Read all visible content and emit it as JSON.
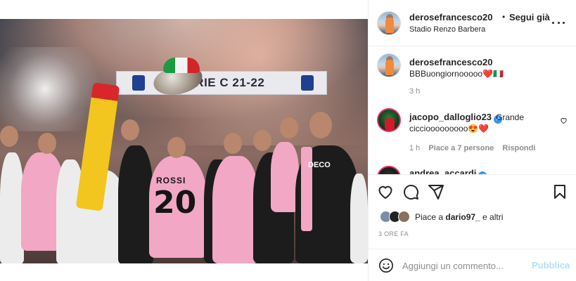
{
  "post": {
    "header": {
      "username": "derosefrancesco20",
      "dot": "•",
      "follow_label": "Segui già",
      "location": "Stadio Renzo Barbera"
    },
    "caption": {
      "username": "derosefrancesco20",
      "text": "BBBuongiornooooo❤️🇮🇹",
      "time": "3 h"
    },
    "comments": [
      {
        "username": "jacopo_dalloglio23",
        "verified": true,
        "text_line1": "Grande",
        "text_line2": "cicciooooooooo😍❤️",
        "time": "1 h",
        "likes": "Piace a 7 persone",
        "reply": "Rispondi"
      },
      {
        "username": "andrea_accardi",
        "verified": true
      }
    ],
    "likes_text_prefix": "Piace a ",
    "likes_user": "dario97_",
    "likes_text_suffix": " e altri",
    "post_time": "3 ORE FA",
    "comment_placeholder": "Aggiungi un commento...",
    "publish_label": "Pubblica"
  },
  "photo": {
    "banner_text": "SERIE C 21-22",
    "jersey_name": "ROSSI",
    "jersey_number": "20",
    "sponsor": "DECO"
  },
  "colors": {
    "accent_link": "#b2dffc",
    "verified": "#3897f0",
    "heart": "#ed4956",
    "text_secondary": "#8e8e8e"
  },
  "icons": [
    "more-icon",
    "heart-icon",
    "comment-icon",
    "share-icon",
    "bookmark-icon",
    "emoji-icon",
    "verified-icon"
  ]
}
